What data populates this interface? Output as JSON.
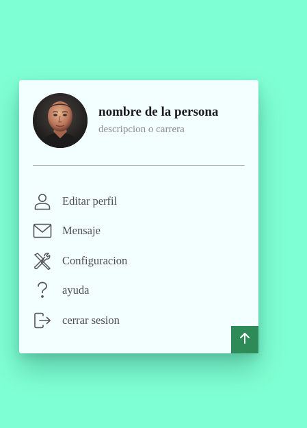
{
  "profile": {
    "name": "nombre de la persona",
    "description": "descripcion o carrera",
    "avatar_icon": "profile-photo"
  },
  "menu": {
    "items": [
      {
        "label": "Editar perfil",
        "icon": "user-icon"
      },
      {
        "label": "Mensaje",
        "icon": "envelope-icon"
      },
      {
        "label": "Configuracion",
        "icon": "tools-icon"
      },
      {
        "label": "ayuda",
        "icon": "question-icon"
      },
      {
        "label": "cerrar sesion",
        "icon": "logout-icon"
      }
    ]
  },
  "scroll_top": {
    "icon": "arrow-up-icon"
  },
  "colors": {
    "page_background": "#7fffd4",
    "card_background": "#f3fffe",
    "accent": "#2e8b57",
    "icon": "#555555",
    "text_secondary": "#8c8c8c"
  }
}
